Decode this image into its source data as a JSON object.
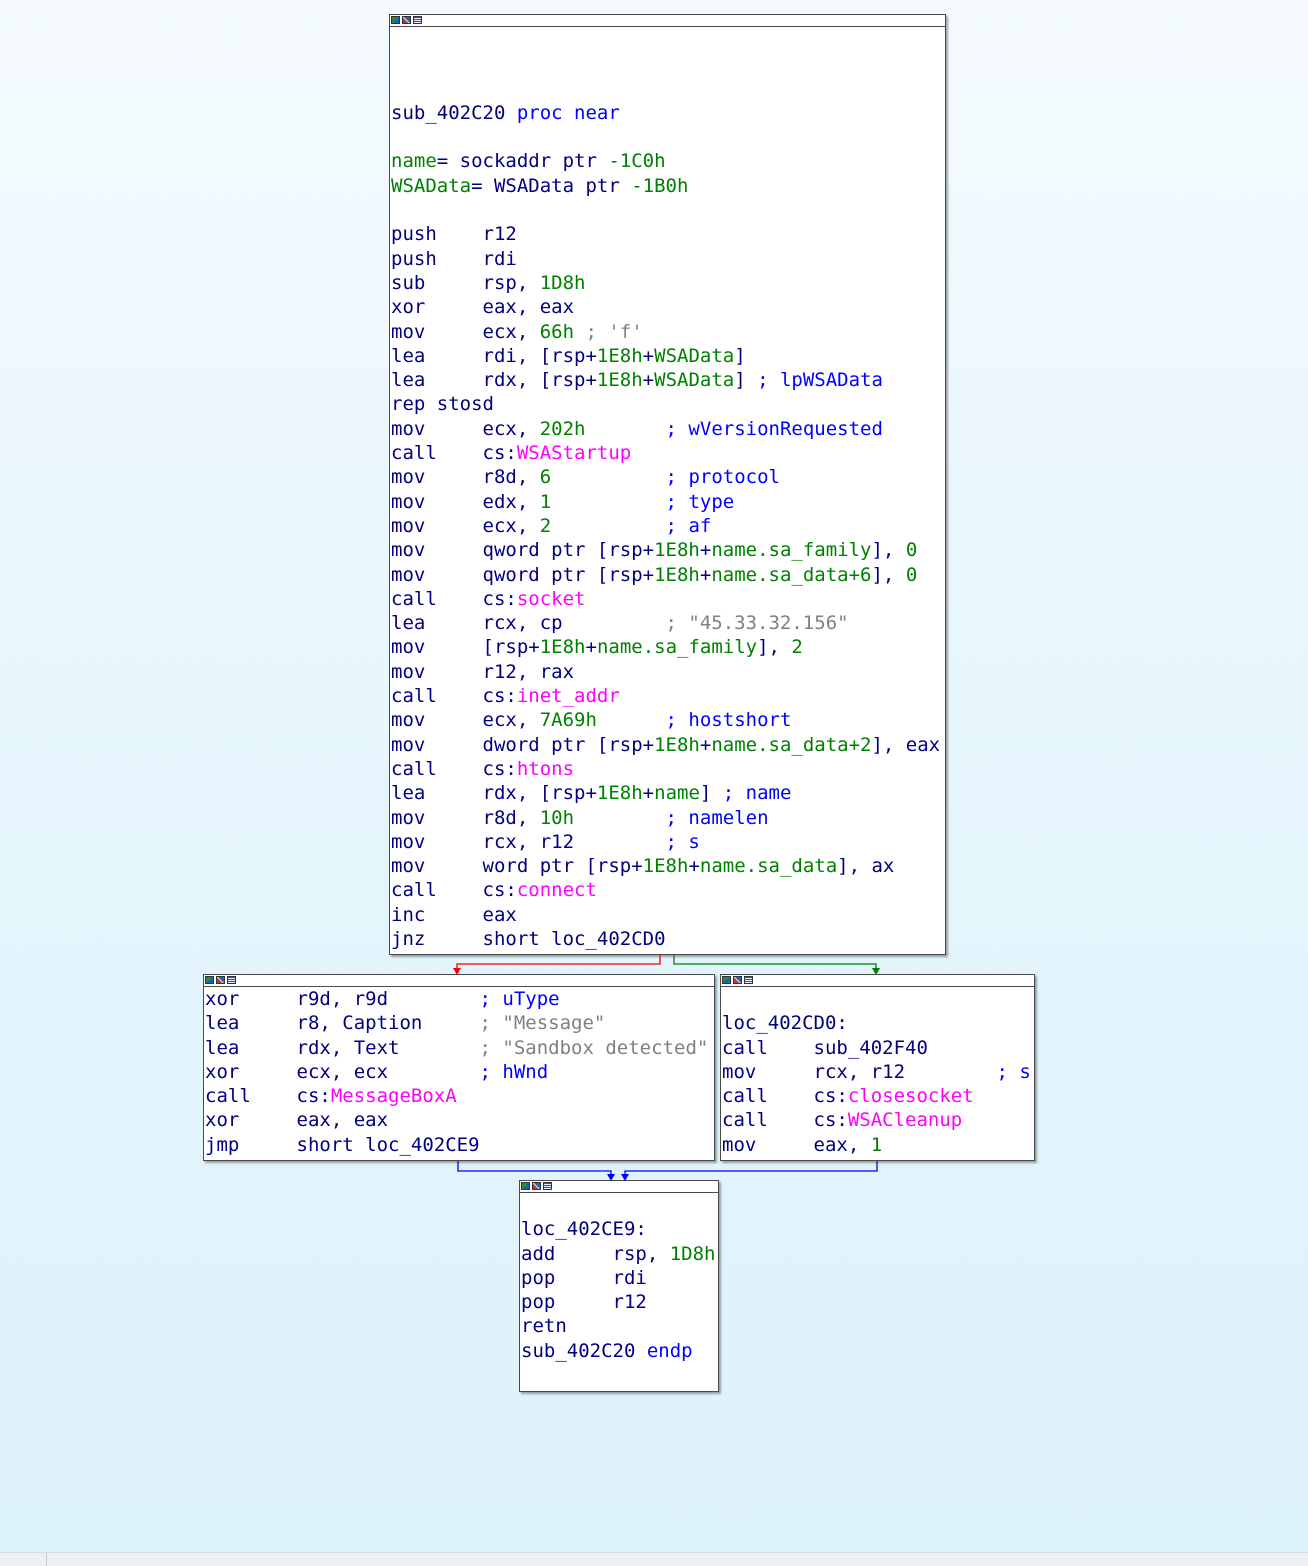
{
  "nodes": {
    "top": {
      "lines": [
        {
          "t": ""
        },
        {
          "t": ""
        },
        {
          "t": ""
        },
        {
          "t": "",
          "spans": [
            {
              "c": "lbl",
              "t": "sub_402C20 "
            },
            {
              "c": "kw",
              "t": "proc near"
            }
          ]
        },
        {
          "t": ""
        },
        {
          "spans": [
            {
              "c": "var",
              "t": "name"
            },
            {
              "c": "mn",
              "t": "= sockaddr ptr "
            },
            {
              "c": "num",
              "t": "-1C0h"
            }
          ]
        },
        {
          "spans": [
            {
              "c": "var",
              "t": "WSAData"
            },
            {
              "c": "mn",
              "t": "= WSAData ptr "
            },
            {
              "c": "num",
              "t": "-1B0h"
            }
          ]
        },
        {
          "t": ""
        },
        {
          "spans": [
            {
              "c": "mn",
              "t": "push    r12"
            }
          ]
        },
        {
          "spans": [
            {
              "c": "mn",
              "t": "push    rdi"
            }
          ]
        },
        {
          "spans": [
            {
              "c": "mn",
              "t": "sub     rsp, "
            },
            {
              "c": "num",
              "t": "1D8h"
            }
          ]
        },
        {
          "spans": [
            {
              "c": "mn",
              "t": "xor     eax, eax"
            }
          ]
        },
        {
          "spans": [
            {
              "c": "mn",
              "t": "mov     ecx, "
            },
            {
              "c": "num",
              "t": "66h"
            },
            {
              "c": "gray",
              "t": " ; 'f'"
            }
          ]
        },
        {
          "spans": [
            {
              "c": "mn",
              "t": "lea     rdi, [rsp+"
            },
            {
              "c": "num",
              "t": "1E8h"
            },
            {
              "c": "mn",
              "t": "+"
            },
            {
              "c": "var",
              "t": "WSAData"
            },
            {
              "c": "mn",
              "t": "]"
            }
          ]
        },
        {
          "spans": [
            {
              "c": "mn",
              "t": "lea     rdx, [rsp+"
            },
            {
              "c": "num",
              "t": "1E8h"
            },
            {
              "c": "mn",
              "t": "+"
            },
            {
              "c": "var",
              "t": "WSAData"
            },
            {
              "c": "mn",
              "t": "]"
            },
            {
              "c": "cm",
              "t": " ; lpWSAData"
            }
          ]
        },
        {
          "spans": [
            {
              "c": "mn",
              "t": "rep stosd"
            }
          ]
        },
        {
          "spans": [
            {
              "c": "mn",
              "t": "mov     ecx, "
            },
            {
              "c": "num",
              "t": "202h"
            },
            {
              "c": "cm",
              "t": "       ; wVersionRequested"
            }
          ]
        },
        {
          "spans": [
            {
              "c": "mn",
              "t": "call    cs:"
            },
            {
              "c": "imp",
              "t": "WSAStartup"
            }
          ]
        },
        {
          "spans": [
            {
              "c": "mn",
              "t": "mov     r8d, "
            },
            {
              "c": "num",
              "t": "6"
            },
            {
              "c": "cm",
              "t": "          ; protocol"
            }
          ]
        },
        {
          "spans": [
            {
              "c": "mn",
              "t": "mov     edx, "
            },
            {
              "c": "num",
              "t": "1"
            },
            {
              "c": "cm",
              "t": "          ; type"
            }
          ]
        },
        {
          "spans": [
            {
              "c": "mn",
              "t": "mov     ecx, "
            },
            {
              "c": "num",
              "t": "2"
            },
            {
              "c": "cm",
              "t": "          ; af"
            }
          ]
        },
        {
          "spans": [
            {
              "c": "mn",
              "t": "mov     qword ptr [rsp+"
            },
            {
              "c": "num",
              "t": "1E8h"
            },
            {
              "c": "mn",
              "t": "+"
            },
            {
              "c": "var",
              "t": "name.sa_family"
            },
            {
              "c": "mn",
              "t": "], "
            },
            {
              "c": "num",
              "t": "0"
            }
          ]
        },
        {
          "spans": [
            {
              "c": "mn",
              "t": "mov     qword ptr [rsp+"
            },
            {
              "c": "num",
              "t": "1E8h"
            },
            {
              "c": "mn",
              "t": "+"
            },
            {
              "c": "var",
              "t": "name.sa_data+6"
            },
            {
              "c": "mn",
              "t": "], "
            },
            {
              "c": "num",
              "t": "0"
            }
          ]
        },
        {
          "spans": [
            {
              "c": "mn",
              "t": "call    cs:"
            },
            {
              "c": "imp",
              "t": "socket"
            }
          ]
        },
        {
          "spans": [
            {
              "c": "mn",
              "t": "lea     rcx, cp"
            },
            {
              "c": "gray",
              "t": "         ; \"45.33.32.156\""
            }
          ]
        },
        {
          "spans": [
            {
              "c": "mn",
              "t": "mov     [rsp+"
            },
            {
              "c": "num",
              "t": "1E8h"
            },
            {
              "c": "mn",
              "t": "+"
            },
            {
              "c": "var",
              "t": "name.sa_family"
            },
            {
              "c": "mn",
              "t": "], "
            },
            {
              "c": "num",
              "t": "2"
            }
          ]
        },
        {
          "spans": [
            {
              "c": "mn",
              "t": "mov     r12, rax"
            }
          ]
        },
        {
          "spans": [
            {
              "c": "mn",
              "t": "call    cs:"
            },
            {
              "c": "imp",
              "t": "inet_addr"
            }
          ]
        },
        {
          "spans": [
            {
              "c": "mn",
              "t": "mov     ecx, "
            },
            {
              "c": "num",
              "t": "7A69h"
            },
            {
              "c": "cm",
              "t": "      ; hostshort"
            }
          ]
        },
        {
          "spans": [
            {
              "c": "mn",
              "t": "mov     dword ptr [rsp+"
            },
            {
              "c": "num",
              "t": "1E8h"
            },
            {
              "c": "mn",
              "t": "+"
            },
            {
              "c": "var",
              "t": "name.sa_data+2"
            },
            {
              "c": "mn",
              "t": "], eax"
            }
          ]
        },
        {
          "spans": [
            {
              "c": "mn",
              "t": "call    cs:"
            },
            {
              "c": "imp",
              "t": "htons"
            }
          ]
        },
        {
          "spans": [
            {
              "c": "mn",
              "t": "lea     rdx, [rsp+"
            },
            {
              "c": "num",
              "t": "1E8h"
            },
            {
              "c": "mn",
              "t": "+"
            },
            {
              "c": "var",
              "t": "name"
            },
            {
              "c": "mn",
              "t": "]"
            },
            {
              "c": "cm",
              "t": " ; name"
            }
          ]
        },
        {
          "spans": [
            {
              "c": "mn",
              "t": "mov     r8d, "
            },
            {
              "c": "num",
              "t": "10h"
            },
            {
              "c": "cm",
              "t": "        ; namelen"
            }
          ]
        },
        {
          "spans": [
            {
              "c": "mn",
              "t": "mov     rcx, r12"
            },
            {
              "c": "cm",
              "t": "        ; s"
            }
          ]
        },
        {
          "spans": [
            {
              "c": "mn",
              "t": "mov     word ptr [rsp+"
            },
            {
              "c": "num",
              "t": "1E8h"
            },
            {
              "c": "mn",
              "t": "+"
            },
            {
              "c": "var",
              "t": "name.sa_data"
            },
            {
              "c": "mn",
              "t": "], ax"
            }
          ]
        },
        {
          "spans": [
            {
              "c": "mn",
              "t": "call    cs:"
            },
            {
              "c": "imp",
              "t": "connect"
            }
          ]
        },
        {
          "spans": [
            {
              "c": "mn",
              "t": "inc     eax"
            }
          ]
        },
        {
          "spans": [
            {
              "c": "mn",
              "t": "jnz     short loc_402CD0"
            }
          ]
        }
      ]
    },
    "left": {
      "lines": [
        {
          "spans": [
            {
              "c": "mn",
              "t": "xor     r9d, r9d"
            },
            {
              "c": "cm",
              "t": "        ; uType"
            }
          ]
        },
        {
          "spans": [
            {
              "c": "mn",
              "t": "lea     r8, Caption"
            },
            {
              "c": "gray",
              "t": "     ; \"Message\""
            }
          ]
        },
        {
          "spans": [
            {
              "c": "mn",
              "t": "lea     rdx, Text"
            },
            {
              "c": "gray",
              "t": "       ; \"Sandbox detected\""
            }
          ]
        },
        {
          "spans": [
            {
              "c": "mn",
              "t": "xor     ecx, ecx"
            },
            {
              "c": "cm",
              "t": "        ; hWnd"
            }
          ]
        },
        {
          "spans": [
            {
              "c": "mn",
              "t": "call    cs:"
            },
            {
              "c": "imp",
              "t": "MessageBoxA"
            }
          ]
        },
        {
          "spans": [
            {
              "c": "mn",
              "t": "xor     eax, eax"
            }
          ]
        },
        {
          "spans": [
            {
              "c": "mn",
              "t": "jmp     short loc_402CE9"
            }
          ]
        }
      ]
    },
    "right": {
      "lines": [
        {
          "t": ""
        },
        {
          "spans": [
            {
              "c": "lbl",
              "t": "loc_402CD0:"
            }
          ]
        },
        {
          "spans": [
            {
              "c": "mn",
              "t": "call    sub_402F40"
            }
          ]
        },
        {
          "spans": [
            {
              "c": "mn",
              "t": "mov     rcx, r12"
            },
            {
              "c": "cm",
              "t": "        ; s"
            }
          ]
        },
        {
          "spans": [
            {
              "c": "mn",
              "t": "call    cs:"
            },
            {
              "c": "imp",
              "t": "closesocket"
            }
          ]
        },
        {
          "spans": [
            {
              "c": "mn",
              "t": "call    cs:"
            },
            {
              "c": "imp",
              "t": "WSACleanup"
            }
          ]
        },
        {
          "spans": [
            {
              "c": "mn",
              "t": "mov     eax, "
            },
            {
              "c": "num",
              "t": "1"
            }
          ]
        }
      ]
    },
    "bottom": {
      "lines": [
        {
          "t": ""
        },
        {
          "spans": [
            {
              "c": "lbl",
              "t": "loc_402CE9:"
            }
          ]
        },
        {
          "spans": [
            {
              "c": "mn",
              "t": "add     rsp, "
            },
            {
              "c": "num",
              "t": "1D8h"
            }
          ]
        },
        {
          "spans": [
            {
              "c": "mn",
              "t": "pop     rdi"
            }
          ]
        },
        {
          "spans": [
            {
              "c": "mn",
              "t": "pop     r12"
            }
          ]
        },
        {
          "spans": [
            {
              "c": "mn",
              "t": "retn"
            }
          ]
        },
        {
          "spans": [
            {
              "c": "lbl",
              "t": "sub_402C20 "
            },
            {
              "c": "kw",
              "t": "endp"
            }
          ]
        }
      ]
    }
  },
  "colors": {
    "edge_false": "#ff0000",
    "edge_true": "#008000",
    "edge_jump": "#0000ff"
  }
}
